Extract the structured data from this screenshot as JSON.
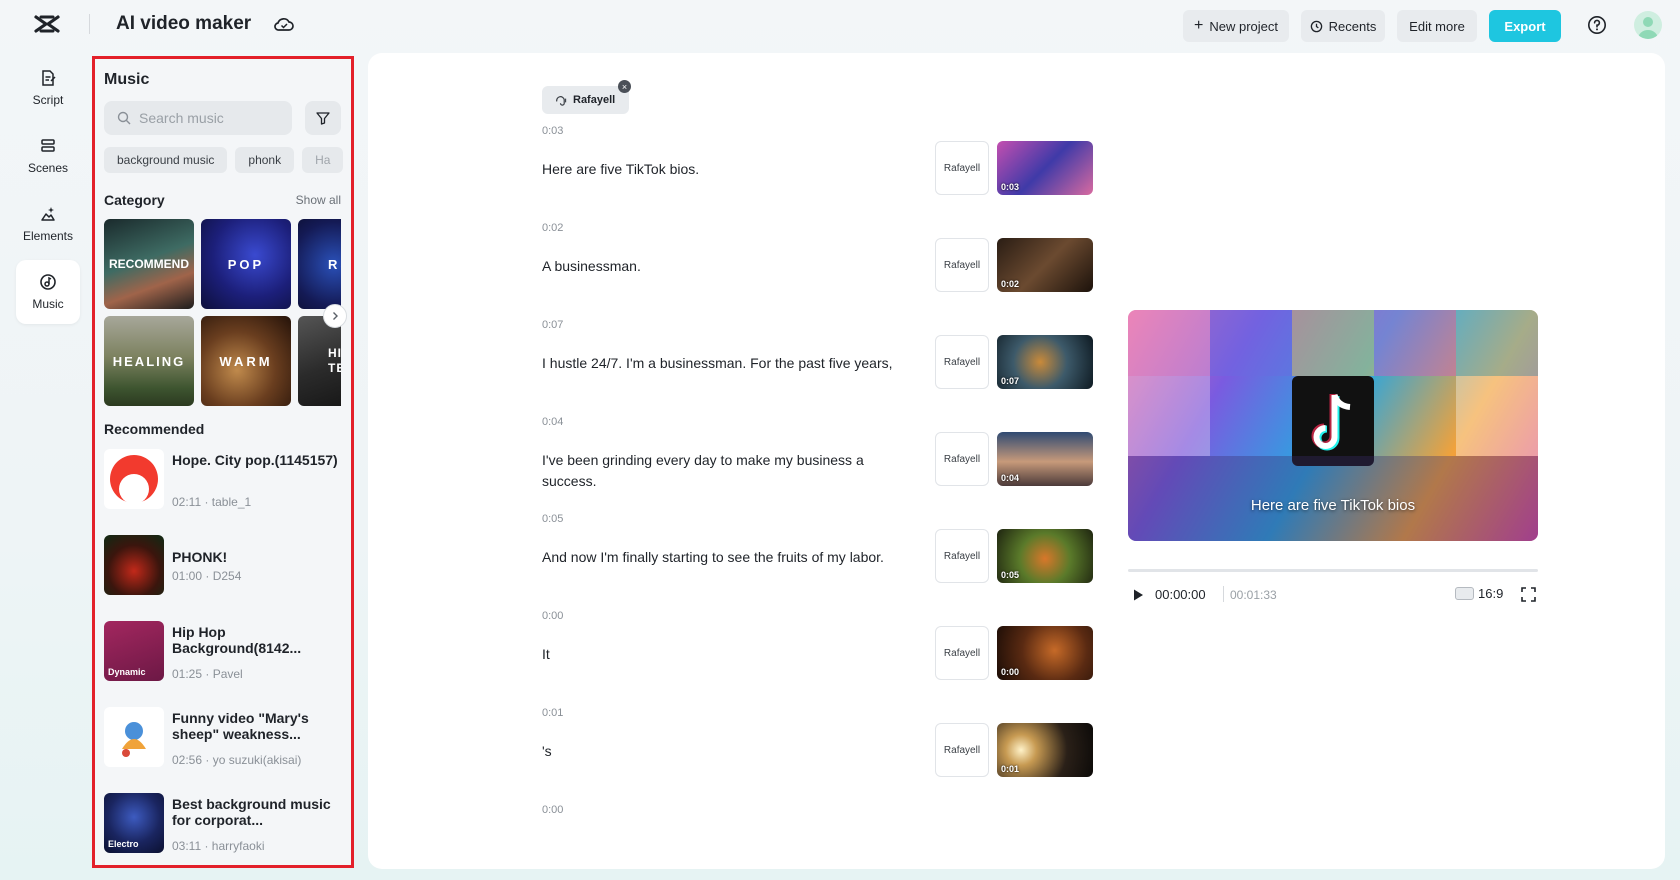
{
  "header": {
    "app_title": "AI video maker",
    "new_project": "New project",
    "recents": "Recents",
    "edit_more": "Edit more",
    "export": "Export",
    "accent_color": "#1ec6e0"
  },
  "rail": {
    "items": [
      {
        "label": "Script",
        "icon": "script-icon"
      },
      {
        "label": "Scenes",
        "icon": "scenes-icon"
      },
      {
        "label": "Elements",
        "icon": "elements-icon"
      },
      {
        "label": "Music",
        "icon": "music-icon",
        "active": true
      }
    ]
  },
  "music": {
    "title": "Music",
    "search_placeholder": "Search music",
    "chips": [
      "background music",
      "phonk",
      "Ha"
    ],
    "category_title": "Category",
    "show_all": "Show all",
    "categories": [
      "RECOMMEND",
      "POP",
      "R&",
      "HEALING",
      "WARM",
      "HIG TEN"
    ],
    "recommended_title": "Recommended",
    "tracks": [
      {
        "name": "Hope. City pop.(1145157)",
        "meta": "02:11 · table_1",
        "tag": ""
      },
      {
        "name": "PHONK!",
        "meta": "01:00 · D254",
        "tag": ""
      },
      {
        "name": "Hip Hop Background(8142...",
        "meta": "01:25 · Pavel",
        "tag": "Dynamic"
      },
      {
        "name": "Funny video \"Mary's sheep\" weakness...",
        "meta": "02:56 · yo suzuki(akisai)",
        "tag": ""
      },
      {
        "name": "Best background music for corporat...",
        "meta": "03:11 · harryfaoki",
        "tag": "Electro"
      }
    ]
  },
  "script": {
    "speaker": "Rafayell",
    "scenes": [
      {
        "time": "0:03",
        "text": "Here are five TikTok bios.",
        "voice": "Rafayell",
        "duration": "0:03"
      },
      {
        "time": "0:02",
        "text": "A businessman.",
        "voice": "Rafayell",
        "duration": "0:02"
      },
      {
        "time": "0:07",
        "text": "I hustle 24/7. I'm a businessman. For the past five years,",
        "voice": "Rafayell",
        "duration": "0:07"
      },
      {
        "time": "0:04",
        "text": "I've been grinding every day to make my business a success.",
        "voice": "Rafayell",
        "duration": "0:04"
      },
      {
        "time": "0:05",
        "text": "And now I'm finally starting to see the fruits of my labor.",
        "voice": "Rafayell",
        "duration": "0:05"
      },
      {
        "time": "0:00",
        "text": "It",
        "voice": "Rafayell",
        "duration": "0:00"
      },
      {
        "time": "0:01",
        "text": "'s",
        "voice": "Rafayell",
        "duration": "0:01"
      },
      {
        "time": "0:00",
        "text": "",
        "voice": "",
        "duration": ""
      }
    ]
  },
  "preview": {
    "caption": "Here are five TikTok bios",
    "current_time": "00:00:00",
    "total_time": "00:01:33",
    "aspect_ratio": "16:9",
    "progress": 0
  }
}
